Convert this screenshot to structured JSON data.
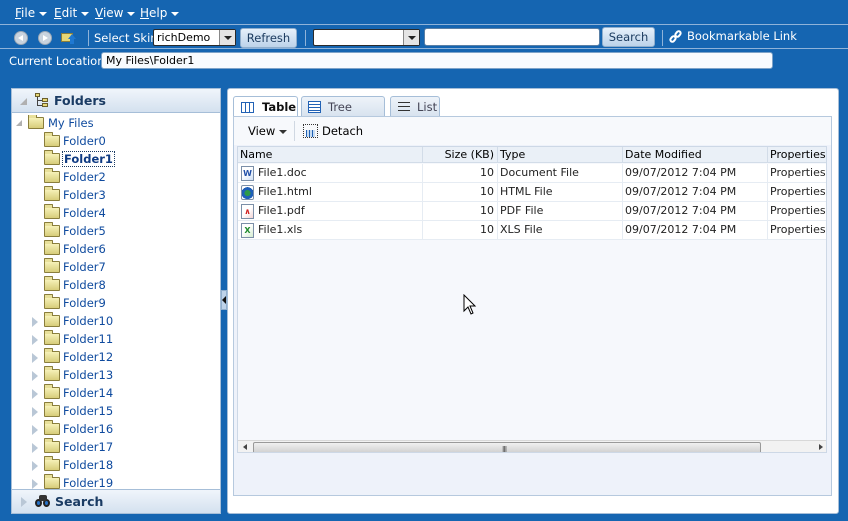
{
  "menubar": {
    "items": [
      {
        "label": "File",
        "mnemonic": "F",
        "rest": "ile"
      },
      {
        "label": "Edit",
        "mnemonic": "E",
        "rest": "dit"
      },
      {
        "label": "View",
        "mnemonic": "V",
        "rest": "iew"
      },
      {
        "label": "Help",
        "mnemonic": "H",
        "rest": "elp"
      }
    ]
  },
  "toolbar": {
    "back_icon": "back-arrow-icon",
    "forward_icon": "forward-arrow-icon",
    "up_icon": "folder-up-icon",
    "skin_label": "Select Skin",
    "skin_value": "richDemo",
    "refresh_label": "Refresh",
    "search_scope_value": "",
    "search_query": "",
    "search_label": "Search",
    "bookmark_label": "Bookmarkable Link",
    "bookmark_icon": "chain-link-icon"
  },
  "location": {
    "label": "Current Location:",
    "value": "My Files\\Folder1"
  },
  "left_panel": {
    "title": "Folders",
    "title_icon": "folder-tree-icon",
    "root": "My Files",
    "selected": "Folder1",
    "folders": [
      "Folder0",
      "Folder1",
      "Folder2",
      "Folder3",
      "Folder4",
      "Folder5",
      "Folder6",
      "Folder7",
      "Folder8",
      "Folder9",
      "Folder10",
      "Folder11",
      "Folder12",
      "Folder13",
      "Folder14",
      "Folder15",
      "Folder16",
      "Folder17",
      "Folder18",
      "Folder19"
    ],
    "expandable_from_index": 10,
    "footer_title": "Search",
    "footer_icon": "binoculars-icon"
  },
  "right_panel": {
    "tabs": [
      {
        "label": "Table",
        "icon": "table-icon",
        "active": true
      },
      {
        "label": "Tree Table",
        "icon": "tree-table-icon",
        "active": false
      },
      {
        "label": "List",
        "icon": "list-icon",
        "active": false
      }
    ],
    "view_menu_label": "View",
    "detach_label": "Detach",
    "columns": [
      "Name",
      "Size (KB)",
      "Type",
      "Date Modified",
      "Properties"
    ],
    "rows": [
      {
        "name": "File1.doc",
        "icon": "word-doc-icon",
        "size": "10",
        "type": "Document File",
        "modified": "09/07/2012 7:04 PM",
        "properties": "Properties"
      },
      {
        "name": "File1.html",
        "icon": "html-globe-icon",
        "size": "10",
        "type": "HTML File",
        "modified": "09/07/2012 7:04 PM",
        "properties": "Properties"
      },
      {
        "name": "File1.pdf",
        "icon": "pdf-icon",
        "size": "10",
        "type": "PDF File",
        "modified": "09/07/2012 7:04 PM",
        "properties": "Properties"
      },
      {
        "name": "File1.xls",
        "icon": "excel-xls-icon",
        "size": "10",
        "type": "XLS File",
        "modified": "09/07/2012 7:04 PM",
        "properties": "Properties"
      }
    ],
    "scroll_grip": "III"
  },
  "colors": {
    "background": "#1565b1",
    "link": "#0e3a9e",
    "tree_text": "#0e4a9e"
  }
}
